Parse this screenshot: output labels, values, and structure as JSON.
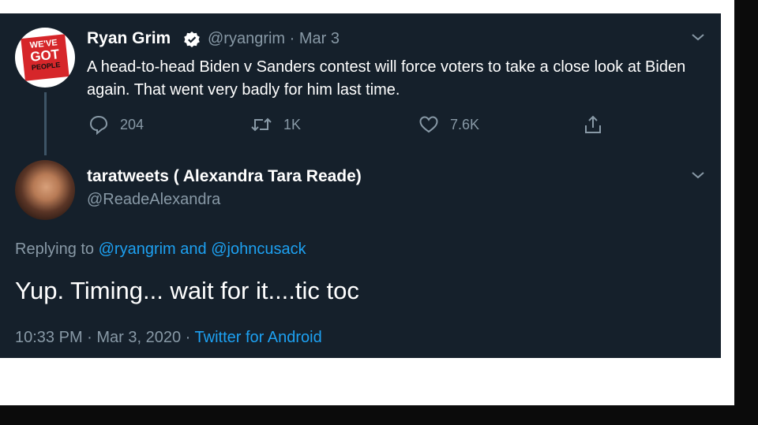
{
  "colors": {
    "background": "#15202b",
    "text_primary": "#ffffff",
    "text_secondary": "#8899a6",
    "link": "#1da1f2"
  },
  "tweet_1": {
    "avatar_sign": {
      "line1": "WE'VE",
      "line2": "GOT",
      "line3": "PEOPLE"
    },
    "display_name": "Ryan Grim",
    "verified": true,
    "handle_and_date": "@ryangrim · Mar 3",
    "text": "A head-to-head Biden v Sanders contest will force voters to take a close look at Biden again. That went very badly for him last time.",
    "actions": {
      "reply_count": "204",
      "retweet_count": "1K",
      "like_count": "7.6K"
    },
    "icons": [
      "chevron-down-icon",
      "verified-badge-icon",
      "reply-icon",
      "retweet-icon",
      "like-icon",
      "share-icon"
    ]
  },
  "tweet_2": {
    "display_name": "taratweets ( Alexandra Tara Reade)",
    "handle": "@ReadeAlexandra",
    "replying_prefix": "Replying to",
    "replying_user_1": "@ryangrim",
    "replying_and": "and",
    "replying_user_2": "@johncusack",
    "text": "Yup. Timing... wait for it....tic toc",
    "timestamp": "10:33 PM · Mar 3, 2020 ·",
    "source": "Twitter for Android"
  }
}
